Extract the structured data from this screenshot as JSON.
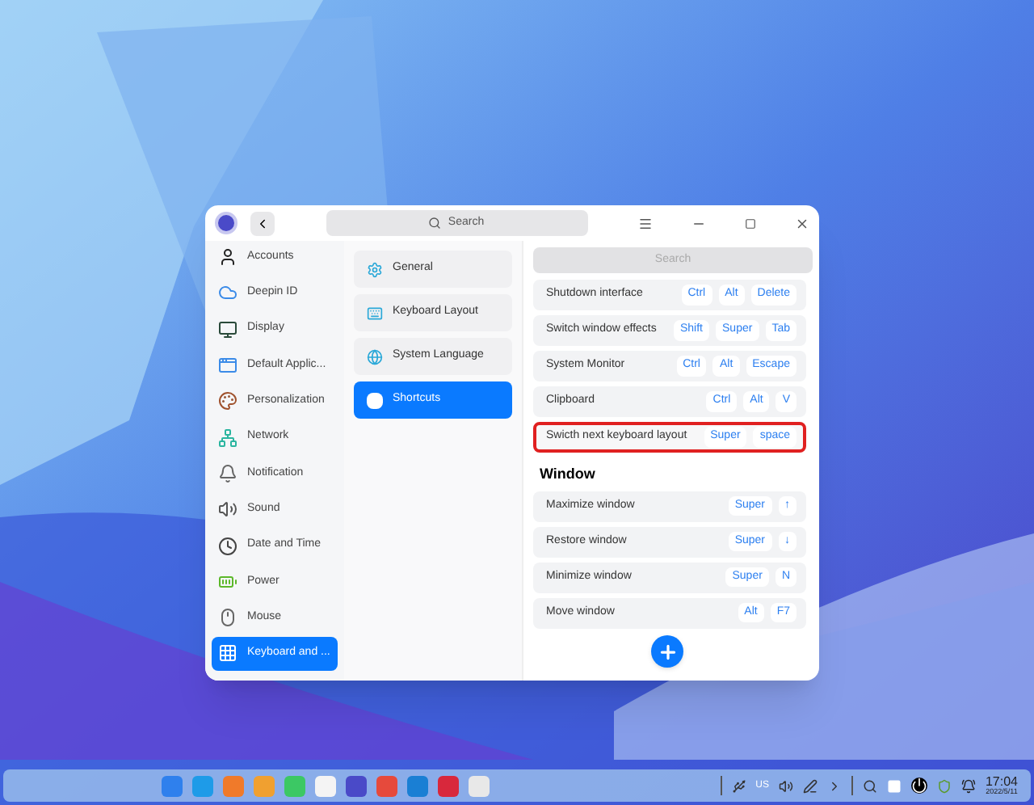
{
  "title_bar": {
    "search_placeholder": "Search"
  },
  "sidebar": {
    "items": [
      {
        "label": "Accounts",
        "selected": false
      },
      {
        "label": "Deepin ID",
        "selected": false
      },
      {
        "label": "Display",
        "selected": false
      },
      {
        "label": "Default Applic...",
        "selected": false
      },
      {
        "label": "Personalization",
        "selected": false
      },
      {
        "label": "Network",
        "selected": false
      },
      {
        "label": "Notification",
        "selected": false
      },
      {
        "label": "Sound",
        "selected": false
      },
      {
        "label": "Date and Time",
        "selected": false
      },
      {
        "label": "Power",
        "selected": false
      },
      {
        "label": "Mouse",
        "selected": false
      },
      {
        "label": "Keyboard and ...",
        "selected": true
      }
    ]
  },
  "categories": [
    {
      "label": "General",
      "selected": false
    },
    {
      "label": "Keyboard Layout",
      "selected": false
    },
    {
      "label": "System Language",
      "selected": false
    },
    {
      "label": "Shortcuts",
      "selected": true
    }
  ],
  "shortcuts": {
    "search_placeholder": "Search",
    "rows": [
      {
        "kind": "shortcut",
        "name": "Shutdown interface",
        "keys": [
          "Ctrl",
          "Alt",
          "Delete"
        ],
        "highlighted": false
      },
      {
        "kind": "shortcut",
        "name": "Switch window effects",
        "keys": [
          "Shift",
          "Super",
          "Tab"
        ],
        "highlighted": false
      },
      {
        "kind": "shortcut",
        "name": "System Monitor",
        "keys": [
          "Ctrl",
          "Alt",
          "Escape"
        ],
        "highlighted": false
      },
      {
        "kind": "shortcut",
        "name": "Clipboard",
        "keys": [
          "Ctrl",
          "Alt",
          "V"
        ],
        "highlighted": false
      },
      {
        "kind": "shortcut",
        "name": "Swicth next keyboard layout",
        "keys": [
          "Super",
          "space"
        ],
        "highlighted": true
      },
      {
        "kind": "heading",
        "name": "Window"
      },
      {
        "kind": "shortcut",
        "name": "Maximize window",
        "keys": [
          "Super",
          "↑"
        ],
        "highlighted": false
      },
      {
        "kind": "shortcut",
        "name": "Restore window",
        "keys": [
          "Super",
          "↓"
        ],
        "highlighted": false
      },
      {
        "kind": "shortcut",
        "name": "Minimize window",
        "keys": [
          "Super",
          "N"
        ],
        "highlighted": false
      },
      {
        "kind": "shortcut",
        "name": "Move window",
        "keys": [
          "Alt",
          "F7"
        ],
        "highlighted": false
      }
    ]
  },
  "taskbar": {
    "apps": [
      {
        "color": "#2f80ed"
      },
      {
        "color": "#1e9be8"
      },
      {
        "color": "#f07a2a"
      },
      {
        "color": "#f0a030"
      },
      {
        "color": "#3cc864"
      },
      {
        "color": "#f4f4f4"
      },
      {
        "color": "#4a4ac8"
      },
      {
        "color": "#e64a3c"
      },
      {
        "color": "#1a7fd4"
      },
      {
        "color": "#d8283c"
      },
      {
        "color": "#e8e8e8"
      }
    ],
    "layout_indicator": "US",
    "time": "17:04",
    "date": "2022/5/11"
  }
}
